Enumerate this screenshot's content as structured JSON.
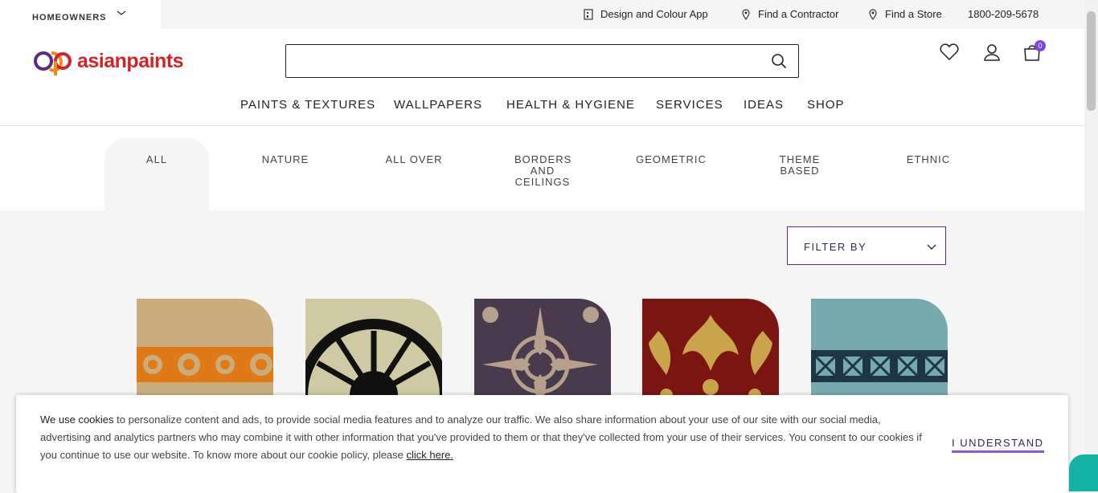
{
  "topbar": {
    "segment_label": "HOMEOWNERS",
    "links": [
      {
        "label": "Design and Colour App",
        "icon": "building-icon"
      },
      {
        "label": "Find a Contractor",
        "icon": "location-pin-icon"
      },
      {
        "label": "Find a Store",
        "icon": "location-pin-icon"
      },
      {
        "label": "1800-209-5678",
        "icon": ""
      }
    ]
  },
  "header": {
    "logo_text": "asianpaints",
    "search": {
      "placeholder": "",
      "value": ""
    },
    "cart_count": "0"
  },
  "main_nav": [
    "PAINTS & TEXTURES",
    "WALLPAPERS",
    "HEALTH & HYGIENE",
    "SERVICES",
    "IDEAS",
    "SHOP"
  ],
  "categories": [
    {
      "label": "ALL",
      "active": true
    },
    {
      "label": "NATURE",
      "active": false
    },
    {
      "label": "ALL OVER",
      "active": false
    },
    {
      "label": "BORDERS AND CEILINGS",
      "active": false
    },
    {
      "label": "GEOMETRIC",
      "active": false
    },
    {
      "label": "THEME BASED",
      "active": false
    },
    {
      "label": "ETHNIC",
      "active": false
    }
  ],
  "filter": {
    "label": "FILTER BY"
  },
  "products": [
    {
      "name": "orange-scroll-border-stencil",
      "bg": "#c9ad7c",
      "pattern": "#e07a16"
    },
    {
      "name": "black-medallion-stencil",
      "bg": "#cfc9a4",
      "pattern": "#111111"
    },
    {
      "name": "purple-medallion-stencil",
      "bg": "#4a3a4e",
      "pattern": "#b6a08c"
    },
    {
      "name": "red-gold-damask-stencil",
      "bg": "#7a1512",
      "pattern": "#c9a44a"
    },
    {
      "name": "teal-geometric-border-stencil",
      "bg": "#76aab0",
      "pattern": "#1e3548"
    }
  ],
  "cookie": {
    "lead": "We use cookies",
    "text": " to personalize content and ads, to provide social media features and to analyze our traffic. We also share information about your use of our site with our social media, advertising and analytics partners who may combine it with other information that you've provided to them or that they've collected from your use of their services. You consent to our cookies if you continue to use our website. To know more about our cookie policy, please ",
    "link": "click here.",
    "button": "I UNDERSTAND"
  },
  "colors": {
    "brand_red": "#d2232a",
    "brand_purple": "#5b2a86",
    "accent": "#7b44e6",
    "chat": "#15b3a6"
  }
}
